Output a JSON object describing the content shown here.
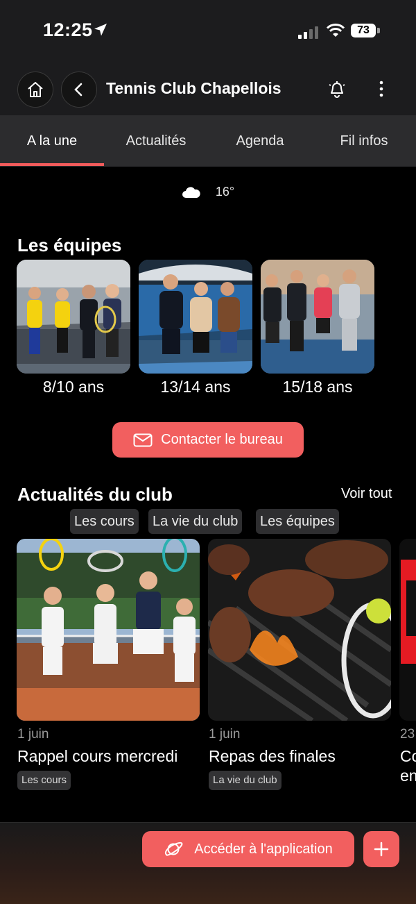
{
  "status_bar": {
    "time": "12:25",
    "battery": "73"
  },
  "header": {
    "title": "Tennis Club Chapellois"
  },
  "tabs": [
    {
      "label": "A la une"
    },
    {
      "label": "Actualités"
    },
    {
      "label": "Agenda"
    },
    {
      "label": "Fil infos"
    }
  ],
  "weather": {
    "temperature": "16°",
    "icon": "cloud-icon"
  },
  "teams": {
    "title": "Les équipes",
    "items": [
      {
        "label": "8/10 ans"
      },
      {
        "label": "13/14 ans"
      },
      {
        "label": "15/18 ans"
      }
    ]
  },
  "contact_button": {
    "label": "Contacter le bureau",
    "icon": "mail-icon"
  },
  "news": {
    "title": "Actualités du club",
    "see_all": "Voir tout",
    "filters": [
      "Les cours",
      "La vie du club",
      "Les équipes"
    ],
    "items": [
      {
        "date": "1 juin",
        "title": "Rappel cours mercredi",
        "tag": "Les cours"
      },
      {
        "date": "1 juin",
        "title": "Repas des finales",
        "tag": "La vie du club"
      },
      {
        "date": "23",
        "title": "Co",
        "title2": "en"
      }
    ]
  },
  "bottom": {
    "access_label": "Accéder à l'application",
    "access_icon": "planet-icon",
    "add_icon": "plus-icon"
  },
  "colors": {
    "accent": "#f25f5f",
    "background": "#000000",
    "bar": "#1c1c1e",
    "tabs": "#2c2c2e"
  }
}
